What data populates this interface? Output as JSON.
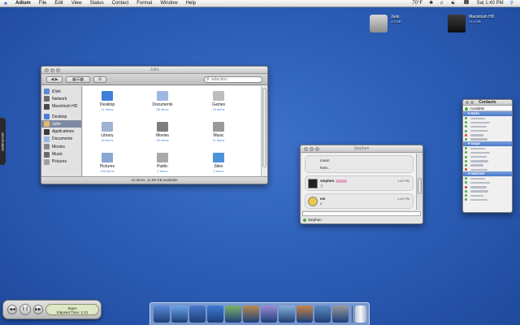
{
  "menubar": {
    "app": "Adium",
    "items": [
      "File",
      "Edit",
      "View",
      "Status",
      "Contact",
      "Format",
      "Window",
      "Help"
    ],
    "temperature": "70°F",
    "clock": "Sat 1:40 PM"
  },
  "desktop": {
    "icons": [
      {
        "name": "Junk",
        "sub": "4.0 GB"
      },
      {
        "name": "Macintosh HD",
        "sub": "74.4 GB"
      }
    ]
  },
  "finder": {
    "title": "Jufer",
    "search_placeholder": "selection",
    "sidebar": [
      {
        "label": "iDisk",
        "color": "#5b8ad6"
      },
      {
        "label": "Network",
        "color": "#6c6c6c"
      },
      {
        "label": "Macintosh HD",
        "color": "#4a4a4a"
      },
      {
        "label": "Desktop",
        "color": "#4d7fd4"
      },
      {
        "label": "Jufer",
        "color": "#e4b769",
        "selected": true
      },
      {
        "label": "Applications",
        "color": "#3b3b3b"
      },
      {
        "label": "Documents",
        "color": "#9ab6e4"
      },
      {
        "label": "Movies",
        "color": "#8a8a8a"
      },
      {
        "label": "Music",
        "color": "#6a6a6a"
      },
      {
        "label": "Pictures",
        "color": "#a0a0a0"
      }
    ],
    "items": [
      {
        "name": "Desktop",
        "sub": "11 items",
        "color": "#3f7fd8"
      },
      {
        "name": "Documents",
        "sub": "58 items",
        "color": "#9db8e2"
      },
      {
        "name": "Games",
        "sub": "18 items",
        "color": "#bdbdbd"
      },
      {
        "name": "Library",
        "sub": "49 items",
        "color": "#9fb3cf"
      },
      {
        "name": "Movies",
        "sub": "30 items",
        "color": "#7d7d7d"
      },
      {
        "name": "Music",
        "sub": "11 items",
        "color": "#9a9a9a"
      },
      {
        "name": "Pictures",
        "sub": "335 items",
        "color": "#8aa7cf"
      },
      {
        "name": "Public",
        "sub": "2 items",
        "color": "#a9a9a9"
      },
      {
        "name": "Sites",
        "sub": "4 items",
        "color": "#4e92d9"
      }
    ],
    "status": "10 items, 11.99 GB available"
  },
  "chat": {
    "title": "Stephen",
    "top_lines": [
      "music",
      "here..."
    ],
    "messages": [
      {
        "name": "stephen",
        "time": "1:40 PM",
        "text": ":)",
        "avatar": "#222"
      },
      {
        "name": "me",
        "time": "1:40 PM",
        "text": "x",
        "avatar": "#e9c84a"
      }
    ],
    "footer": "Stephen"
  },
  "contacts": {
    "title": "Contacts",
    "status": "Available",
    "groups": [
      {
        "name": "Girls",
        "dots": [
          "#4caa3e",
          "#4caa3e",
          "#4caa3e",
          "#4caa3e",
          "#d23c2c",
          "#4caa3e"
        ]
      },
      {
        "name": "Guys",
        "dots": [
          "#4caa3e",
          "#4caa3e",
          "#4caa3e",
          "#4caa3e",
          "#4caa3e",
          "#d23c2c"
        ]
      },
      {
        "name": "Internet",
        "dots": [
          "#4caa3e",
          "#4caa3e",
          "#d23c2c",
          "#4caa3e",
          "#4caa3e",
          "#4caa3e"
        ]
      }
    ]
  },
  "itunes": {
    "track": "Signs",
    "elapsed": "Elapsed Time: 1:21"
  },
  "dock": {
    "items": [
      {
        "name": "finder",
        "color": "#5a8ad8"
      },
      {
        "name": "safari",
        "color": "#6ba7e8"
      },
      {
        "name": "mail",
        "color": "#4979c9"
      },
      {
        "name": "ichat",
        "color": "#3e7ad6"
      },
      {
        "name": "itunes",
        "color": "#7bb36a"
      },
      {
        "name": "addressbook",
        "color": "#b88b4a"
      },
      {
        "name": "adium",
        "color": "#9c8bd3"
      },
      {
        "name": "preview",
        "color": "#8ab0d8"
      },
      {
        "name": "iphoto",
        "color": "#c5854b"
      },
      {
        "name": "photoshop",
        "color": "#5c8dc0"
      },
      {
        "name": "system-prefs",
        "color": "#9a9a9a"
      }
    ],
    "trash": "trash"
  },
  "drawer_label": "NOVEMBER"
}
